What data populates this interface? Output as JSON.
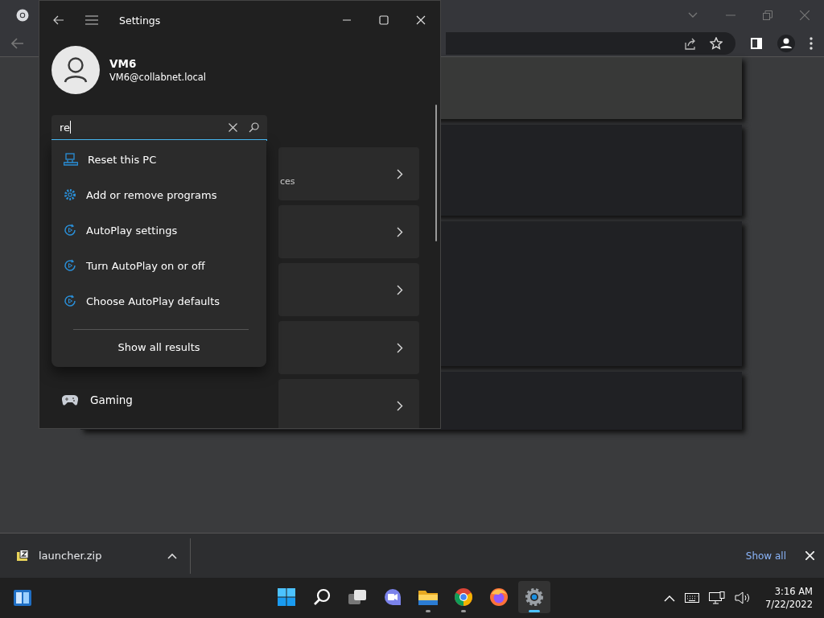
{
  "settings_window": {
    "title": "Settings",
    "user": {
      "name": "VM6",
      "email": "VM6@collabnet.local"
    },
    "search": {
      "value": "re"
    },
    "results": [
      {
        "label": "Reset this PC",
        "kind": "reset"
      },
      {
        "label": "Add or remove programs",
        "kind": "gear"
      },
      {
        "label": "AutoPlay settings",
        "kind": "autoplay"
      },
      {
        "label": "Turn AutoPlay on or off",
        "kind": "autoplay"
      },
      {
        "label": "Choose AutoPlay defaults",
        "kind": "autoplay"
      }
    ],
    "show_all": "Show all results",
    "nav": [
      {
        "label": "Gaming",
        "kind": "gamepad"
      }
    ],
    "card_text": "ces"
  },
  "downloads": {
    "file": "launcher.zip",
    "show_all": "Show all"
  },
  "taskbar": {
    "apps": [
      {
        "kind": "start",
        "running": false,
        "selected": false
      },
      {
        "kind": "search",
        "running": false,
        "selected": false
      },
      {
        "kind": "taskview",
        "running": false,
        "selected": false
      },
      {
        "kind": "chat",
        "running": false,
        "selected": false
      },
      {
        "kind": "explorer",
        "running": true,
        "selected": false
      },
      {
        "kind": "chrome",
        "running": true,
        "selected": false
      },
      {
        "kind": "firefox",
        "running": false,
        "selected": false
      },
      {
        "kind": "settings",
        "running": true,
        "selected": true
      }
    ],
    "clock": {
      "time": "3:16 AM",
      "date": "7/22/2022"
    }
  }
}
